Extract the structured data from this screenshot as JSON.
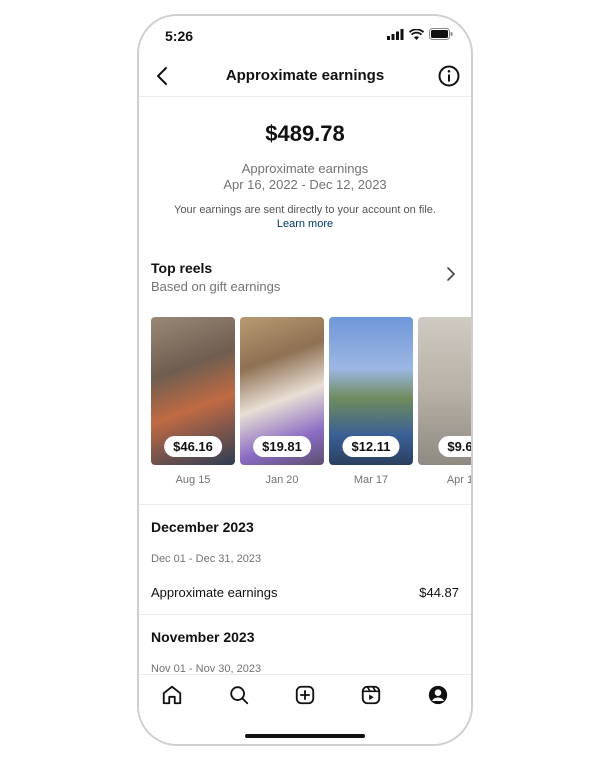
{
  "status": {
    "time": "5:26"
  },
  "header": {
    "title": "Approximate earnings"
  },
  "summary": {
    "amount": "$489.78",
    "label": "Approximate earnings",
    "range": "Apr 16, 2022 - Dec 12, 2023",
    "note": "Your earnings are sent directly to your account on file.",
    "learn_more": "Learn more"
  },
  "top_reels": {
    "title": "Top reels",
    "subtitle": "Based on gift earnings",
    "items": [
      {
        "price": "$46.16",
        "date": "Aug 15"
      },
      {
        "price": "$19.81",
        "date": "Jan 20"
      },
      {
        "price": "$12.11",
        "date": "Mar 17"
      },
      {
        "price": "$9.6",
        "date": "Apr 1"
      }
    ]
  },
  "months": [
    {
      "title": "December 2023",
      "range": "Dec 01 - Dec 31, 2023",
      "row_label": "Approximate earnings",
      "row_value": "$44.87"
    },
    {
      "title": "November 2023",
      "range": "Nov 01 - Nov 30, 2023"
    }
  ],
  "tabs": [
    "home-icon",
    "search-icon",
    "create-icon",
    "reels-icon",
    "profile-icon"
  ]
}
